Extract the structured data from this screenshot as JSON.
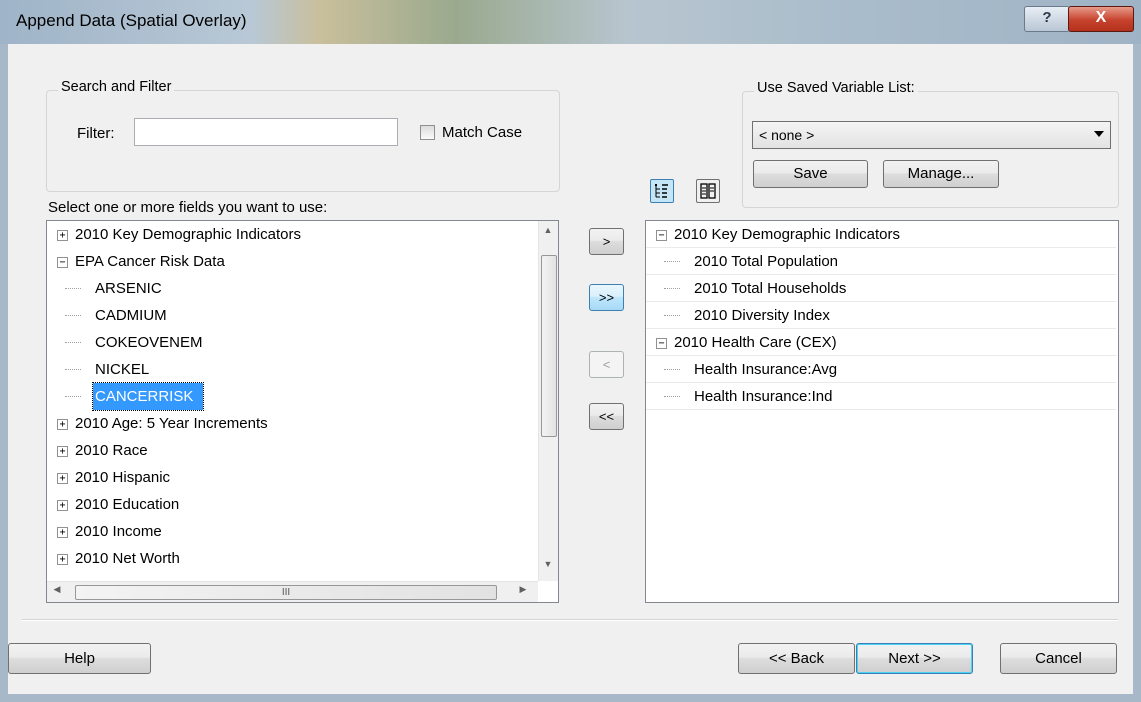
{
  "window": {
    "title": "Append Data (Spatial Overlay)",
    "help_glyph": "?",
    "close_glyph": "X"
  },
  "search": {
    "group_title": "Search and Filter",
    "filter_label": "Filter:",
    "filter_value": "",
    "match_case_label": "Match Case",
    "match_case_checked": false
  },
  "saved_list": {
    "group_title": "Use Saved Variable List:",
    "selected": "< none >",
    "save_label": "Save",
    "manage_label": "Manage..."
  },
  "left_list": {
    "instruction": "Select one or more fields you want to use:",
    "items": [
      {
        "label": "2010 Key Demographic Indicators",
        "level": 0,
        "expander": "+"
      },
      {
        "label": "EPA Cancer Risk Data",
        "level": 0,
        "expander": "−"
      },
      {
        "label": "ARSENIC",
        "level": 1
      },
      {
        "label": "CADMIUM",
        "level": 1
      },
      {
        "label": "COKEOVENEM",
        "level": 1
      },
      {
        "label": "NICKEL",
        "level": 1
      },
      {
        "label": "CANCERRISK",
        "level": 1,
        "selected": true
      },
      {
        "label": "2010 Age: 5 Year Increments",
        "level": 0,
        "expander": "+"
      },
      {
        "label": "2010 Race",
        "level": 0,
        "expander": "+"
      },
      {
        "label": "2010 Hispanic",
        "level": 0,
        "expander": "+"
      },
      {
        "label": "2010 Education",
        "level": 0,
        "expander": "+"
      },
      {
        "label": "2010 Income",
        "level": 0,
        "expander": "+"
      },
      {
        "label": "2010 Net Worth",
        "level": 0,
        "expander": "+"
      }
    ],
    "hscroll_grip": "III"
  },
  "transfer_buttons": {
    "add_one": ">",
    "add_all": ">>",
    "remove_one": "<",
    "remove_all": "<<"
  },
  "right_list": {
    "items": [
      {
        "label": "2010 Key Demographic Indicators",
        "level": 0,
        "expander": "−"
      },
      {
        "label": "2010 Total Population",
        "level": 1
      },
      {
        "label": "2010 Total Households",
        "level": 1
      },
      {
        "label": "2010 Diversity Index",
        "level": 1
      },
      {
        "label": "2010 Health Care (CEX)",
        "level": 0,
        "expander": "−"
      },
      {
        "label": "Health Insurance:Avg",
        "level": 1
      },
      {
        "label": "Health Insurance:Ind",
        "level": 1
      }
    ]
  },
  "footer": {
    "help_label": "Help",
    "back_label": "<< Back",
    "next_label": "Next >>",
    "cancel_label": "Cancel"
  }
}
